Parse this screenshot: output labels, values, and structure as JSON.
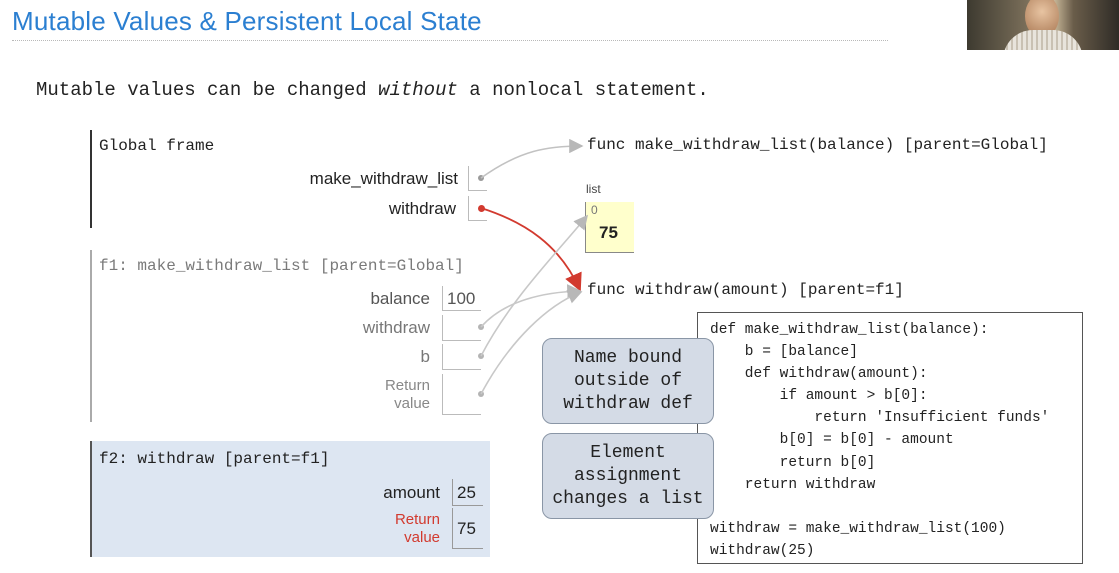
{
  "slide_title": "Mutable Values & Persistent Local State",
  "subtitle": {
    "before": "Mutable values can be changed ",
    "emphasis": "without",
    "after": " a nonlocal statement."
  },
  "global_frame": {
    "label": "Global frame",
    "vars": [
      {
        "name": "make_withdraw_list"
      },
      {
        "name": "withdraw"
      }
    ]
  },
  "f1_frame": {
    "label": "f1: make_withdraw_list [parent=Global]",
    "vars": [
      {
        "name": "balance",
        "value": "100"
      },
      {
        "name": "withdraw"
      },
      {
        "name": "b"
      },
      {
        "name": "Return value",
        "line1": "Return",
        "line2": "value"
      }
    ]
  },
  "f2_frame": {
    "label": "f2: withdraw [parent=f1]",
    "vars": [
      {
        "name": "amount",
        "value": "25"
      },
      {
        "line1": "Return",
        "line2": "value",
        "value": "75"
      }
    ]
  },
  "objects": {
    "func_make": "func make_withdraw_list(balance) [parent=Global]",
    "list_label": "list",
    "list_index": "0",
    "list_value": "75",
    "func_withdraw": "func withdraw(amount) [parent=f1]"
  },
  "code_lines": [
    "def make_withdraw_list(balance):",
    "    b = [balance]",
    "    def withdraw(amount):",
    "        if amount > b[0]:",
    "            return 'Insufficient funds'",
    "        b[0] = b[0] - amount",
    "        return b[0]",
    "    return withdraw",
    "",
    "withdraw = make_withdraw_list(100)",
    "withdraw(25)"
  ],
  "callouts": {
    "name_bound": "Name bound\noutside of\nwithdraw def",
    "element_assignment": "Element\nassignment\nchanges a list"
  },
  "colors": {
    "title": "#2b7fd1",
    "f2_background": "#dde6f2",
    "list_background": "#ffffcc",
    "return_value_label": "#d23a2f",
    "active_pointer": "#d23a2f",
    "callout_fill": "#d4dbe6"
  }
}
